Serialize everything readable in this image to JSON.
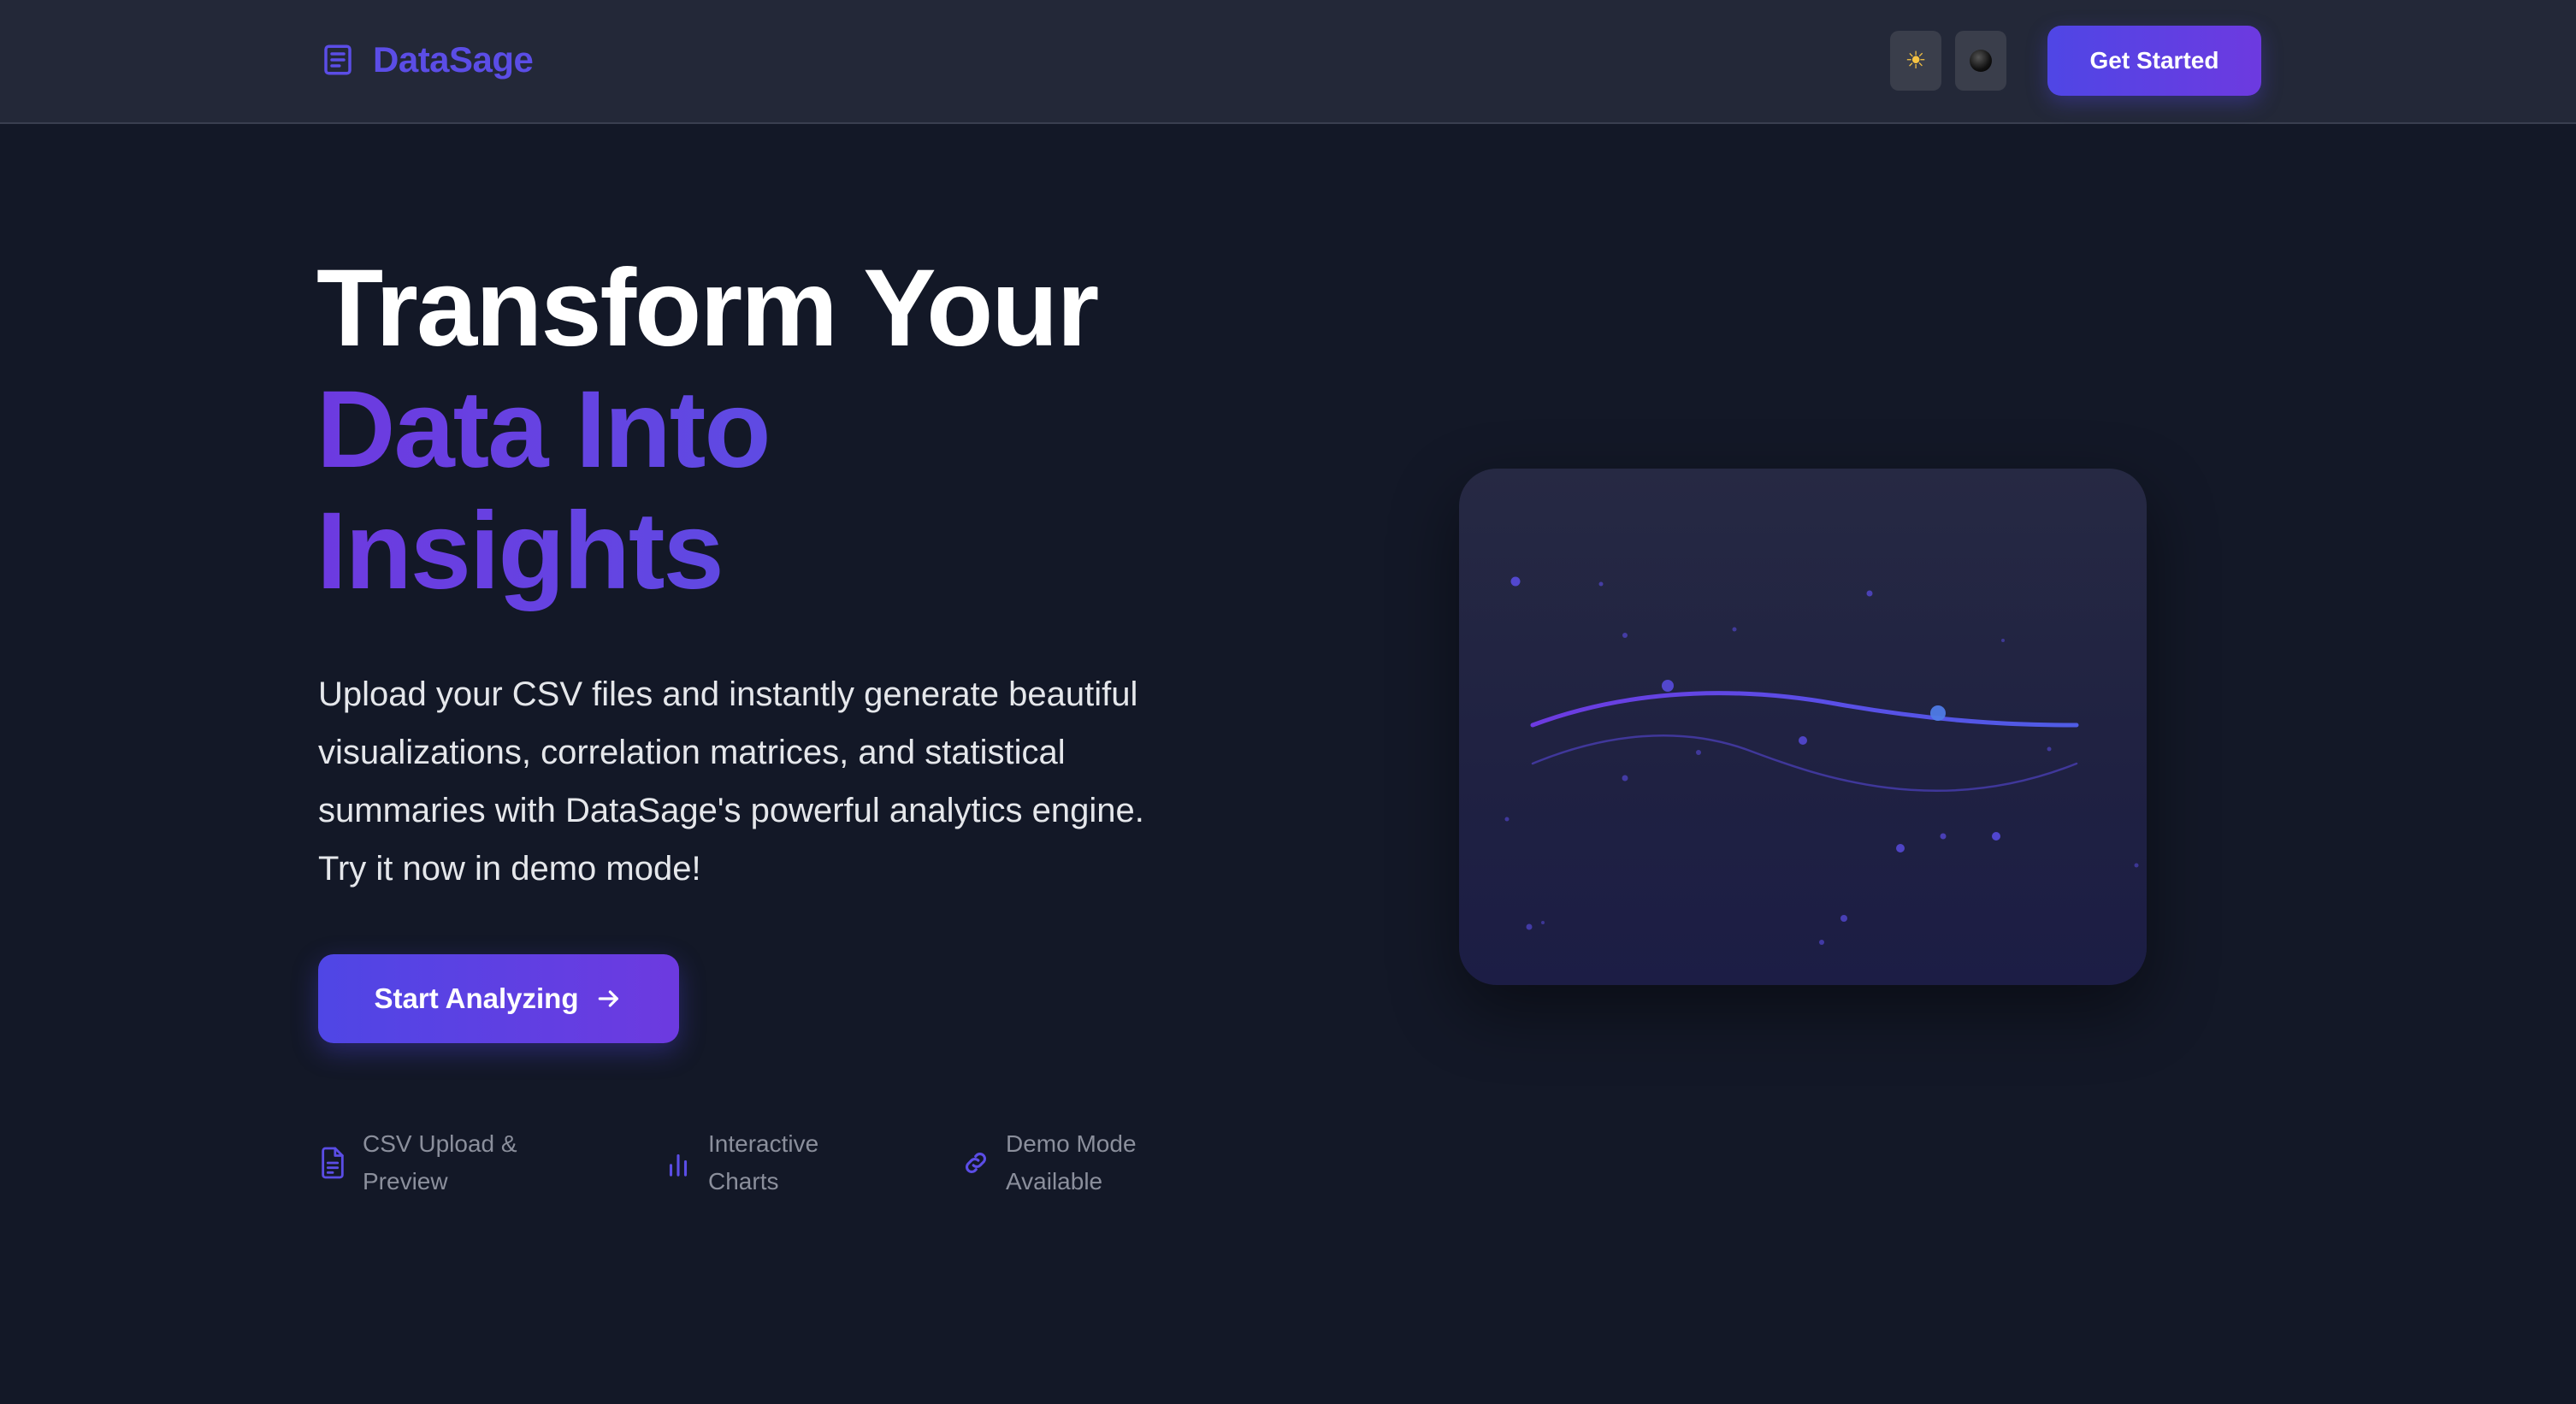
{
  "header": {
    "logo_text": "DataSage",
    "logo_icon": "document-icon",
    "theme_buttons": [
      {
        "name": "sun-icon",
        "glyph": "☀"
      },
      {
        "name": "moon-icon"
      }
    ],
    "cta_label": "Get Started"
  },
  "hero": {
    "title_line_1": "Transform Your",
    "title_line_2": "Data Into",
    "title_line_3": "Insights",
    "description": "Upload your CSV files and instantly generate beautiful visualizations, correlation matrices, and statistical summaries with DataSage's powerful analytics engine. Try it now in demo mode!",
    "cta_label": "Start Analyzing",
    "cta_icon": "arrow-right-icon"
  },
  "features": [
    {
      "label": "CSV Upload & Preview",
      "icon": "file-text-icon"
    },
    {
      "label": "Interactive Charts",
      "icon": "bar-chart-icon"
    },
    {
      "label": "Demo Mode Available",
      "icon": "link-icon"
    }
  ],
  "colors": {
    "accent": "#4f46e5",
    "accent_purple": "#6d3ae0",
    "background": "#131827",
    "header_bg": "#232838",
    "muted_text": "#8b8f9c"
  }
}
